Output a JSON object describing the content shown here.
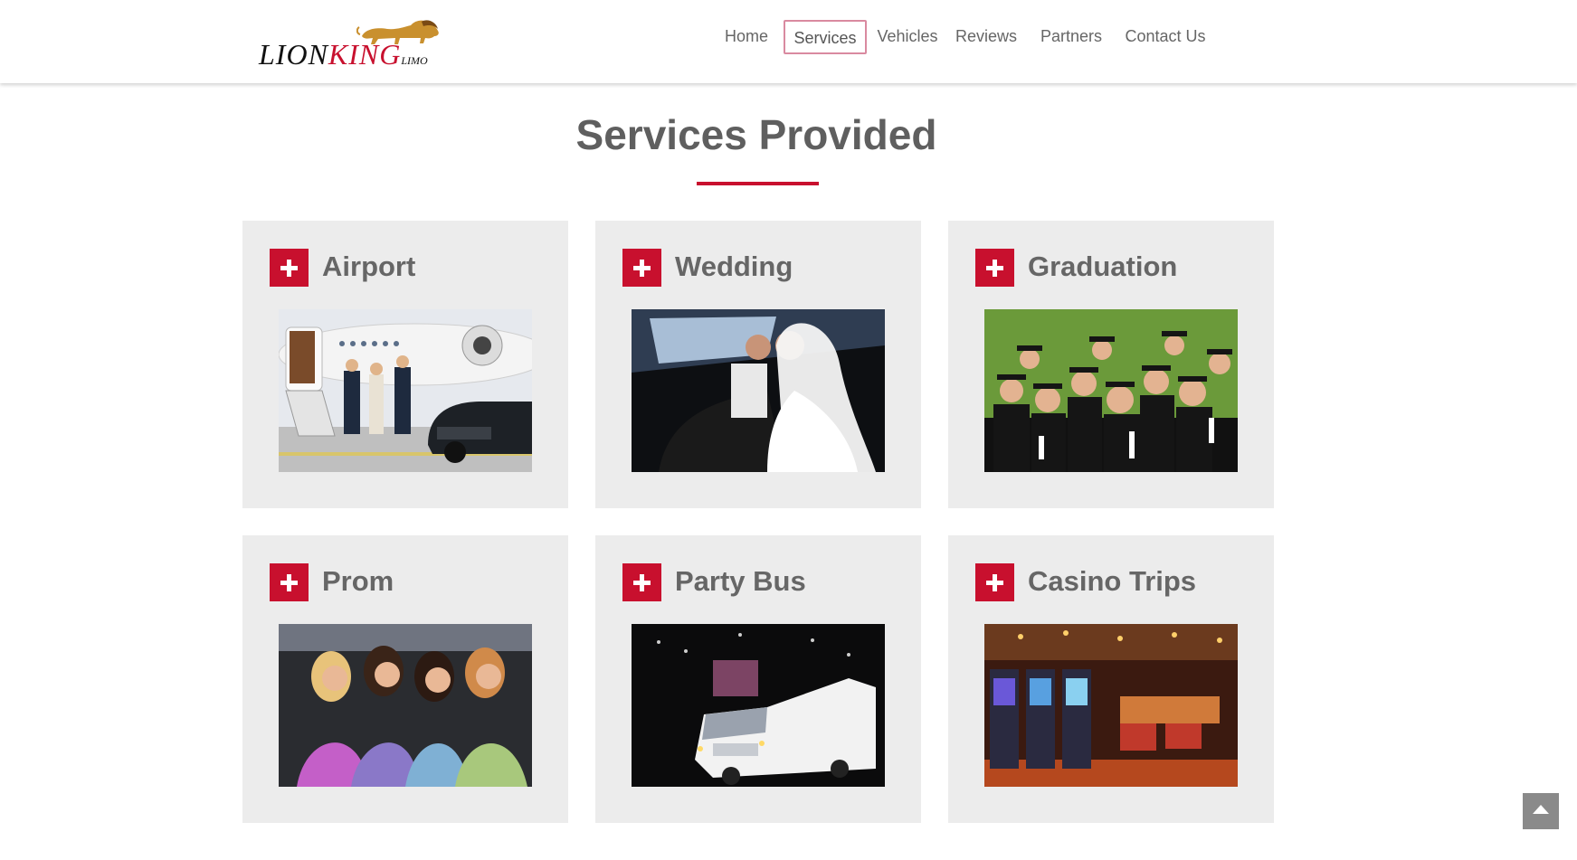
{
  "header": {
    "logo": {
      "part1": "LION",
      "part2": "KING",
      "part3": "LIMO",
      "emblem": "lion-icon"
    },
    "nav": [
      "Home",
      "Services",
      "Vehicles",
      "Reviews",
      "Partners",
      "Contact Us"
    ],
    "active_nav": "Services"
  },
  "main": {
    "title": "Services Provided",
    "services": [
      {
        "label": "Airport",
        "image": "private jet with passengers and black sedan",
        "icon": "plus-icon"
      },
      {
        "label": "Wedding",
        "image": "bride and groom in limousine",
        "icon": "plus-icon"
      },
      {
        "label": "Graduation",
        "image": "group of graduates in caps and gowns",
        "icon": "plus-icon"
      },
      {
        "label": "Prom",
        "image": "four women with champagne in limo",
        "icon": "plus-icon"
      },
      {
        "label": "Party Bus",
        "image": "white party bus with interior lights",
        "icon": "plus-icon"
      },
      {
        "label": "Casino Trips",
        "image": "casino floor with slot machines",
        "icon": "plus-icon"
      }
    ]
  },
  "back_to_top": {
    "icon": "chevron-up-icon"
  },
  "colors": {
    "accent": "#c8102e",
    "card_bg": "#ececec",
    "text": "#666666"
  }
}
